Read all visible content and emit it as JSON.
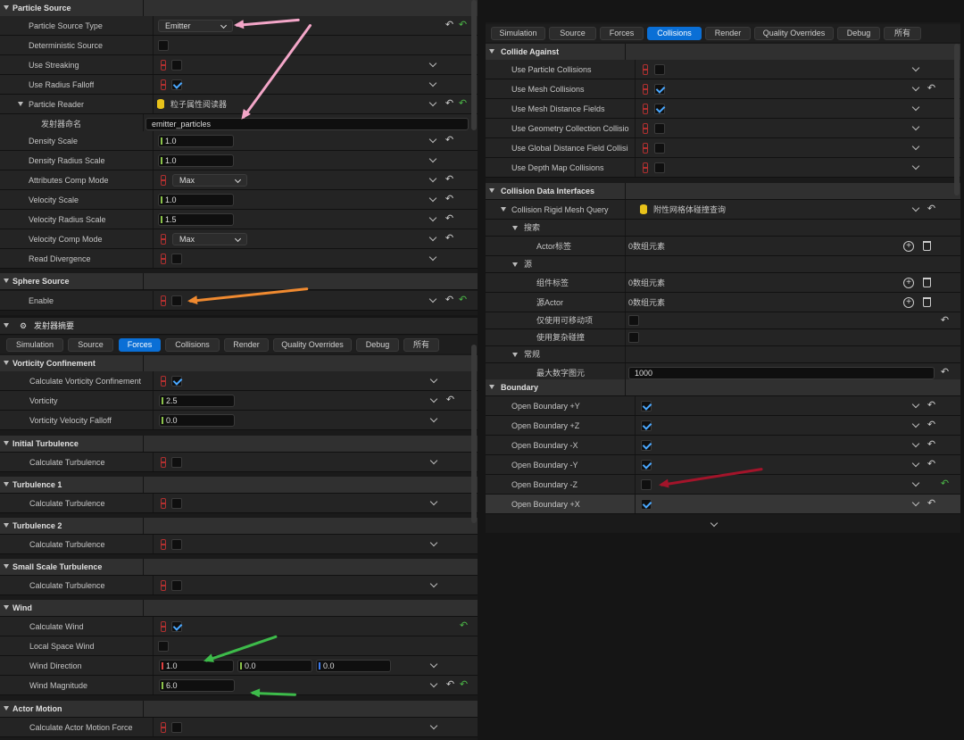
{
  "particle_source": {
    "title": "Particle Source",
    "rows": [
      {
        "label": "Particle Source Type",
        "value": "Emitter"
      },
      {
        "label": "Deterministic Source"
      },
      {
        "label": "Use Streaking"
      },
      {
        "label": "Use Radius Falloff"
      },
      {
        "label": "Particle Reader",
        "value": "粒子属性阅读器"
      },
      {
        "label": "发射器命名",
        "value": "emitter_particles"
      },
      {
        "label": "Density Scale",
        "value": "1.0"
      },
      {
        "label": "Density Radius Scale",
        "value": "1.0"
      },
      {
        "label": "Attributes Comp Mode",
        "value": "Max"
      },
      {
        "label": "Velocity Scale",
        "value": "1.0"
      },
      {
        "label": "Velocity Radius Scale",
        "value": "1.5"
      },
      {
        "label": "Velocity Comp Mode",
        "value": "Max"
      },
      {
        "label": "Read Divergence"
      }
    ]
  },
  "sphere_source": {
    "title": "Sphere Source",
    "enable_label": "Enable"
  },
  "emitter_summary": {
    "title": "发射器摘要"
  },
  "tabs": [
    "Simulation",
    "Source",
    "Forces",
    "Collisions",
    "Render",
    "Quality Overrides",
    "Debug",
    "所有"
  ],
  "forces": {
    "vorticity_confinement": {
      "title": "Vorticity Confinement",
      "rows": [
        {
          "label": "Calculate Vorticity Confinement"
        },
        {
          "label": "Vorticity",
          "value": "2.5"
        },
        {
          "label": "Vorticity Velocity Falloff",
          "value": "0.0"
        }
      ]
    },
    "initial_turbulence": {
      "title": "Initial Turbulence",
      "row": "Calculate Turbulence"
    },
    "turbulence_1": {
      "title": "Turbulence 1",
      "row": "Calculate Turbulence"
    },
    "turbulence_2": {
      "title": "Turbulence 2",
      "row": "Calculate Turbulence"
    },
    "small_scale": {
      "title": "Small Scale Turbulence",
      "row": "Calculate Turbulence"
    },
    "wind": {
      "title": "Wind",
      "rows": [
        {
          "label": "Calculate Wind"
        },
        {
          "label": "Local Space Wind"
        },
        {
          "label": "Wind Direction",
          "x": "1.0",
          "y": "0.0",
          "z": "0.0"
        },
        {
          "label": "Wind Magnitude",
          "value": "6.0"
        }
      ]
    },
    "actor_motion": {
      "title": "Actor Motion",
      "row": "Calculate Actor Motion Force"
    }
  },
  "collisions": {
    "collide_against": {
      "title": "Collide Against",
      "rows": [
        {
          "label": "Use Particle Collisions",
          "checked": false
        },
        {
          "label": "Use Mesh Collisions",
          "checked": true
        },
        {
          "label": "Use Mesh Distance Fields",
          "checked": true
        },
        {
          "label": "Use Geometry Collection Collisio",
          "checked": false
        },
        {
          "label": "Use Global Distance Field Collisi",
          "checked": false
        },
        {
          "label": "Use Depth Map Collisions",
          "checked": false
        }
      ]
    },
    "data_interfaces": {
      "title": "Collision Data Interfaces",
      "query_label": "Collision Rigid Mesh Query",
      "query_value": "附性网格体碰撞查询",
      "search": "搜索",
      "actor_tag": "Actor标签",
      "actor_tag_value": "0数组元素",
      "source": "源",
      "component_tag": "组件标签",
      "component_tag_value": "0数组元素",
      "source_actor": "源Actor",
      "source_actor_value": "0数组元素",
      "movable_only": "仅使用可移动项",
      "complex_collision": "使用复杂碰撞",
      "general": "常规",
      "max_primitives": "最大数字图元",
      "max_primitives_value": "1000"
    },
    "boundary": {
      "title": "Boundary",
      "rows": [
        {
          "label": "Open Boundary +Y",
          "checked": true
        },
        {
          "label": "Open Boundary +Z",
          "checked": true
        },
        {
          "label": "Open Boundary -X",
          "checked": true
        },
        {
          "label": "Open Boundary -Y",
          "checked": true
        },
        {
          "label": "Open Boundary -Z",
          "checked": false
        },
        {
          "label": "Open Boundary +X",
          "checked": true
        }
      ]
    }
  },
  "colors": {
    "accent": "#0a6fd6",
    "check": "#4aa8ff",
    "pink_arrow": "#f3a6c8",
    "orange_arrow": "#f08a30",
    "green_arrow": "#3dbb4a",
    "red_arrow": "#a3142a"
  }
}
